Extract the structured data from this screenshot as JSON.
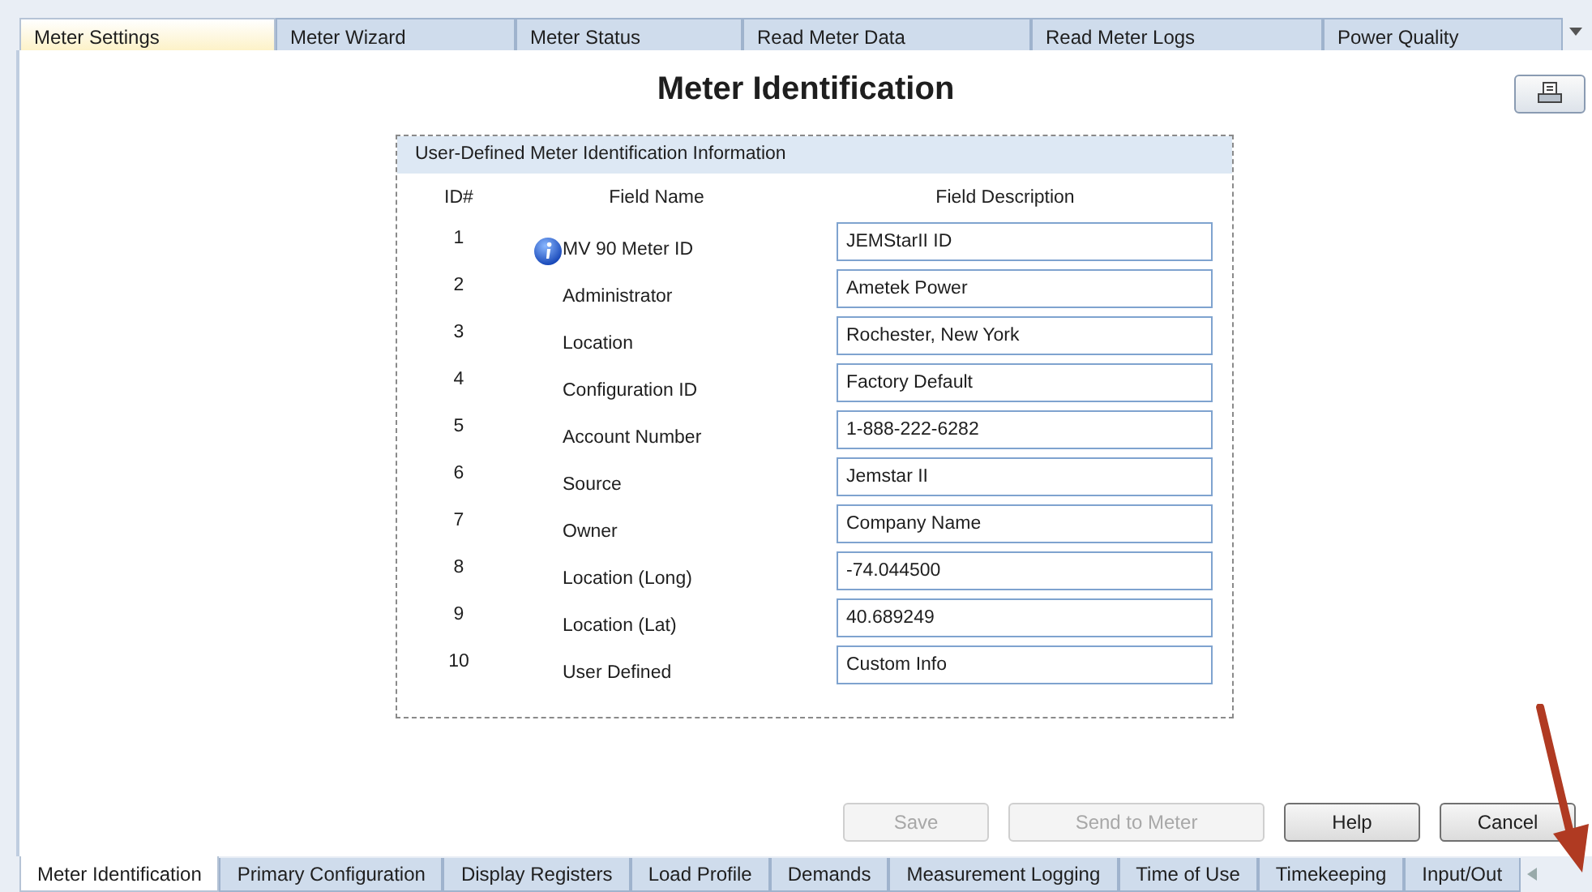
{
  "top_tabs": [
    {
      "label": "Meter Settings",
      "selected": true
    },
    {
      "label": "Meter Wizard",
      "selected": false
    },
    {
      "label": "Meter Status",
      "selected": false
    },
    {
      "label": "Read Meter Data",
      "selected": false
    },
    {
      "label": "Read Meter Logs",
      "selected": false
    },
    {
      "label": "Power Quality",
      "selected": false
    }
  ],
  "title": "Meter Identification",
  "group": {
    "title": "User-Defined Meter Identification Information",
    "columns": [
      "ID#",
      "Field Name",
      "Field Description"
    ],
    "rows": [
      {
        "id": "1",
        "name": "MV 90 Meter ID",
        "value": "JEMStarII ID",
        "info": true
      },
      {
        "id": "2",
        "name": "Administrator",
        "value": "Ametek Power",
        "info": false
      },
      {
        "id": "3",
        "name": "Location",
        "value": "Rochester, New York",
        "info": false
      },
      {
        "id": "4",
        "name": "Configuration ID",
        "value": "Factory Default",
        "info": false
      },
      {
        "id": "5",
        "name": "Account Number",
        "value": "1-888-222-6282",
        "info": false
      },
      {
        "id": "6",
        "name": "Source",
        "value": "Jemstar II",
        "info": false
      },
      {
        "id": "7",
        "name": "Owner",
        "value": "Company Name",
        "info": false
      },
      {
        "id": "8",
        "name": "Location (Long)",
        "value": "-74.044500",
        "info": false
      },
      {
        "id": "9",
        "name": "Location (Lat)",
        "value": "40.689249",
        "info": false
      },
      {
        "id": "10",
        "name": "User Defined",
        "value": "Custom Info",
        "info": false
      }
    ]
  },
  "buttons": [
    {
      "label": "Save",
      "disabled": true
    },
    {
      "label": "Send to Meter",
      "disabled": true
    },
    {
      "label": "Help",
      "disabled": false
    },
    {
      "label": "Cancel",
      "disabled": false
    }
  ],
  "bottom_tabs": [
    {
      "label": "Meter Identification",
      "selected": true
    },
    {
      "label": "Primary Configuration",
      "selected": false
    },
    {
      "label": "Display Registers",
      "selected": false
    },
    {
      "label": "Load Profile",
      "selected": false
    },
    {
      "label": "Demands",
      "selected": false
    },
    {
      "label": "Measurement Logging",
      "selected": false
    },
    {
      "label": "Time of Use",
      "selected": false
    },
    {
      "label": "Timekeeping",
      "selected": false
    },
    {
      "label": "Input/Out",
      "selected": false
    }
  ]
}
